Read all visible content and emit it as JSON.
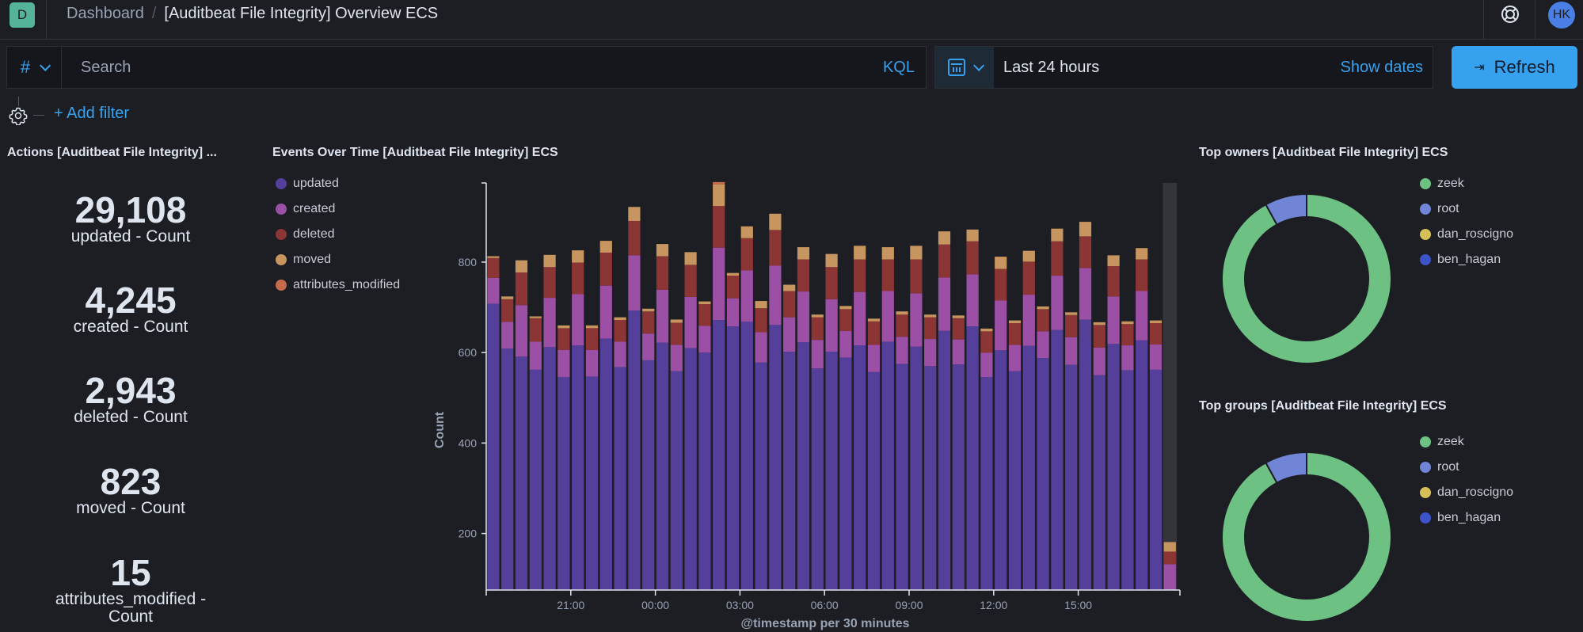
{
  "header": {
    "app_badge": "D",
    "breadcrumbs": [
      "Dashboard",
      "[Auditbeat File Integrity] Overview ECS"
    ],
    "help_icon": "help-icon",
    "avatar_initials": "HK"
  },
  "query": {
    "language_toggle": "#",
    "search_placeholder": "Search",
    "search_value": "",
    "language_label": "KQL"
  },
  "time": {
    "calendar_icon": "calendar-icon",
    "range_label": "Last 24 hours",
    "show_dates_label": "Show dates",
    "refresh_label": "Refresh"
  },
  "filters": {
    "add_filter_label": "+ Add filter"
  },
  "panels": {
    "actions": {
      "title": "Actions [Auditbeat File Integrity] ...",
      "metrics": [
        {
          "value": "29,108",
          "label": "updated - Count"
        },
        {
          "value": "4,245",
          "label": "created - Count"
        },
        {
          "value": "2,943",
          "label": "deleted - Count"
        },
        {
          "value": "823",
          "label": "moved - Count"
        },
        {
          "value": "15",
          "label": "attributes_modified - Count"
        }
      ]
    },
    "events": {
      "title": "Events Over Time [Auditbeat File Integrity] ECS"
    },
    "owners": {
      "title": "Top owners [Auditbeat File Integrity] ECS"
    },
    "groups": {
      "title": "Top groups [Auditbeat File Integrity] ECS"
    }
  },
  "chart_data": [
    {
      "type": "bar",
      "stacked": true,
      "title": "Events Over Time [Auditbeat File Integrity] ECS",
      "xlabel": "@timestamp per 30 minutes",
      "ylabel": "Count",
      "ylim": [
        75,
        975
      ],
      "yticks": [
        200,
        400,
        600,
        800
      ],
      "xticks": [
        "21:00",
        "00:00",
        "03:00",
        "06:00",
        "09:00",
        "12:00",
        "15:00"
      ],
      "xtick_bar_index": [
        6,
        12,
        18,
        24,
        30,
        36,
        42
      ],
      "legend_position": "left",
      "partial_last_bucket": true,
      "series": [
        {
          "name": "updated",
          "color": "#54409a",
          "values": [
            708,
            609,
            591,
            562,
            612,
            546,
            616,
            547,
            631,
            568,
            693,
            583,
            622,
            559,
            610,
            600,
            672,
            658,
            668,
            578,
            661,
            602,
            623,
            565,
            602,
            589,
            616,
            557,
            624,
            575,
            613,
            570,
            648,
            574,
            658,
            546,
            605,
            559,
            615,
            588,
            650,
            573,
            673,
            550,
            619,
            561,
            627,
            562,
            60
          ]
        },
        {
          "name": "created",
          "color": "#9b4fa5",
          "values": [
            57,
            59,
            114,
            62,
            109,
            60,
            113,
            59,
            117,
            56,
            122,
            59,
            117,
            58,
            113,
            59,
            160,
            62,
            114,
            67,
            131,
            76,
            112,
            63,
            116,
            59,
            118,
            60,
            112,
            60,
            118,
            60,
            118,
            55,
            115,
            54,
            110,
            58,
            113,
            59,
            120,
            61,
            114,
            61,
            105,
            55,
            109,
            56,
            72
          ]
        },
        {
          "name": "deleted",
          "color": "#8b3535",
          "values": [
            44,
            50,
            72,
            52,
            68,
            48,
            70,
            48,
            73,
            48,
            76,
            49,
            74,
            49,
            71,
            48,
            92,
            50,
            71,
            53,
            79,
            58,
            71,
            50,
            71,
            48,
            72,
            52,
            70,
            49,
            75,
            48,
            73,
            47,
            73,
            47,
            70,
            48,
            73,
            49,
            76,
            49,
            70,
            50,
            67,
            47,
            70,
            47,
            28
          ]
        },
        {
          "name": "moved",
          "color": "#c7955f",
          "values": [
            4,
            6,
            27,
            4,
            27,
            6,
            27,
            6,
            26,
            6,
            31,
            6,
            27,
            7,
            28,
            6,
            48,
            6,
            26,
            16,
            36,
            14,
            27,
            6,
            29,
            7,
            30,
            6,
            27,
            7,
            30,
            6,
            29,
            6,
            26,
            6,
            27,
            6,
            24,
            6,
            28,
            6,
            32,
            6,
            24,
            6,
            25,
            6,
            21
          ]
        },
        {
          "name": "attributes_modified",
          "color": "#c66b49",
          "values": [
            0,
            0,
            0,
            0,
            0,
            0,
            0,
            0,
            0,
            0,
            0,
            0,
            0,
            0,
            0,
            0,
            5,
            0,
            0,
            0,
            0,
            0,
            0,
            0,
            0,
            0,
            0,
            0,
            0,
            0,
            0,
            0,
            0,
            0,
            0,
            0,
            0,
            0,
            0,
            0,
            0,
            0,
            0,
            0,
            0,
            0,
            0,
            0,
            0
          ]
        }
      ]
    },
    {
      "type": "pie",
      "donut": true,
      "title": "Top owners [Auditbeat File Integrity] ECS",
      "legend_position": "right",
      "labels": [
        "zeek",
        "root",
        "dan_roscigno",
        "ben_hagan"
      ],
      "values": [
        92,
        8,
        0,
        0
      ],
      "unit": "percent",
      "colors": [
        "#6dc283",
        "#7085d6",
        "#d6bf57",
        "#3c53c9"
      ]
    },
    {
      "type": "pie",
      "donut": true,
      "title": "Top groups [Auditbeat File Integrity] ECS",
      "legend_position": "right",
      "labels": [
        "zeek",
        "root",
        "dan_roscigno",
        "ben_hagan"
      ],
      "values": [
        92,
        8,
        0,
        0
      ],
      "unit": "percent",
      "colors": [
        "#6dc283",
        "#7085d6",
        "#d6bf57",
        "#3c53c9"
      ]
    }
  ]
}
